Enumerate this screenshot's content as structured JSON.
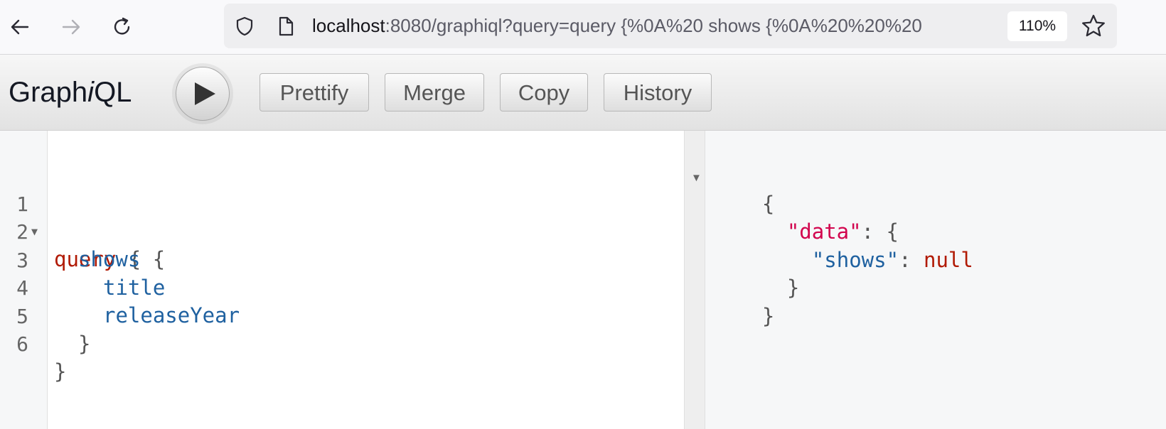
{
  "browser": {
    "url_host": "localhost",
    "url_rest": ":8080/graphiql?query=query {%0A%20 shows {%0A%20%20%20",
    "zoom": "110%"
  },
  "graphiql": {
    "title_prefix": "Graph",
    "title_italic": "i",
    "title_suffix": "QL",
    "buttons": {
      "prettify": "Prettify",
      "merge": "Merge",
      "copy": "Copy",
      "history": "History"
    }
  },
  "editor": {
    "line_numbers": [
      "1",
      "2",
      "3",
      "4",
      "5",
      "6"
    ],
    "lines": {
      "l1_keyword": "query",
      "l1_brace": " {",
      "l2_field": "shows",
      "l2_brace": " {",
      "l3_field": "title",
      "l4_field": "releaseYear",
      "l5_brace": "}",
      "l6_brace": "}"
    }
  },
  "result": {
    "open_brace": "{",
    "data_key": "\"data\"",
    "colon_open": ": {",
    "shows_key": "\"shows\"",
    "colon": ": ",
    "shows_value": "null",
    "inner_close": "}",
    "outer_close": "}"
  },
  "icons": {
    "back": "back-arrow-icon",
    "forward": "forward-arrow-icon",
    "reload": "reload-icon",
    "shield": "shield-icon",
    "page": "page-icon",
    "bookmark": "star-icon",
    "execute": "play-icon"
  }
}
